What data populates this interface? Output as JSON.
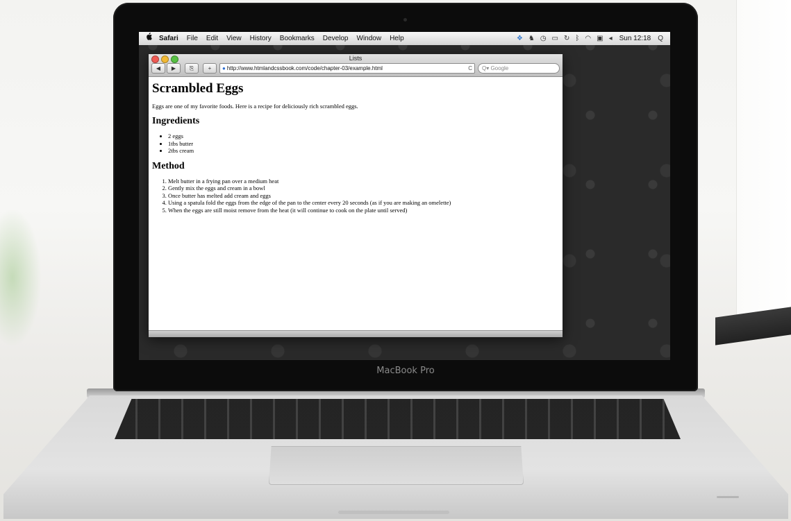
{
  "menubar": {
    "apple": "",
    "items": [
      "Safari",
      "File",
      "Edit",
      "View",
      "History",
      "Bookmarks",
      "Develop",
      "Window",
      "Help"
    ],
    "status_icons": [
      "dropbox-icon",
      "evernote-icon",
      "timemachine-icon",
      "display-icon",
      "sync-icon",
      "bluetooth-icon",
      "wifi-icon",
      "battery-icon",
      "volume-icon"
    ],
    "clock": "Sun 12:18",
    "search_glyph": "Q"
  },
  "window": {
    "title": "Lists",
    "back_glyph": "◀",
    "forward_glyph": "▶",
    "bookmark_glyph": "⎘",
    "add_glyph": "+",
    "url": "http://www.htmlandcssbook.com/code/chapter-03/example.html",
    "reload_glyph": "C",
    "search_placeholder": "Q▾ Google"
  },
  "page": {
    "title": "Scrambled Eggs",
    "intro": "Eggs are one of my favorite foods. Here is a recipe for deliciously rich scrambled eggs.",
    "ingredients_heading": "Ingredients",
    "ingredients": [
      "2 eggs",
      "1tbs butter",
      "2tbs cream"
    ],
    "method_heading": "Method",
    "method": [
      "Melt butter in a frying pan over a medium heat",
      "Gently mix the eggs and cream in a bowl",
      "Once butter has melted add cream and eggs",
      "Using a spatula fold the eggs from the edge of the pan to the center every 20 seconds (as if you are making an omelette)",
      "When the eggs are still moist remove from the heat (it will continue to cook on the plate until served)"
    ]
  },
  "device": {
    "label": "MacBook Pro"
  }
}
